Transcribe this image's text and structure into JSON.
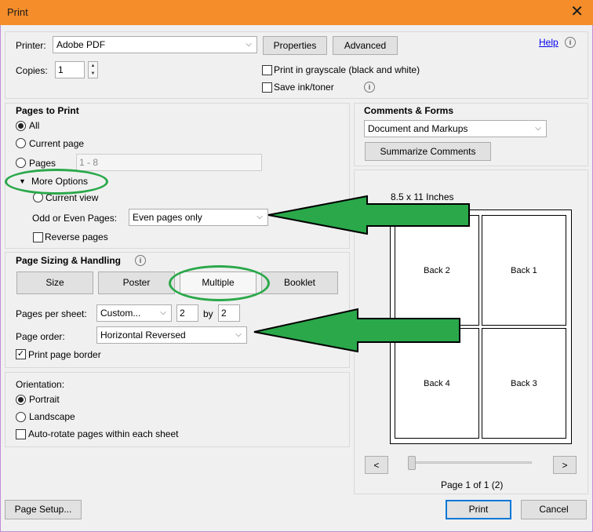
{
  "window": {
    "title": "Print",
    "close_glyph": "✕"
  },
  "printer": {
    "label": "Printer:",
    "value": "Adobe PDF",
    "properties_label": "Properties",
    "advanced_label": "Advanced",
    "help_label": "Help"
  },
  "copies": {
    "label": "Copies:",
    "value": "1"
  },
  "options": {
    "grayscale_label": "Print in grayscale (black and white)",
    "save_ink_label": "Save ink/toner"
  },
  "pages_to_print": {
    "heading": "Pages to Print",
    "all_label": "All",
    "current_page_label": "Current page",
    "pages_label": "Pages",
    "pages_value": "1 - 8",
    "more_options_label": "More Options",
    "current_view_label": "Current view",
    "odd_even_label": "Odd or Even Pages:",
    "odd_even_value": "Even pages only",
    "reverse_label": "Reverse pages"
  },
  "sizing": {
    "heading": "Page Sizing & Handling",
    "tabs": [
      "Size",
      "Poster",
      "Multiple",
      "Booklet"
    ],
    "pages_per_sheet_label": "Pages per sheet:",
    "pages_per_sheet_value": "Custom...",
    "cols_value": "2",
    "by_label": "by",
    "rows_value": "2",
    "page_order_label": "Page order:",
    "page_order_value": "Horizontal Reversed",
    "border_label": "Print page border"
  },
  "orientation": {
    "heading": "Orientation:",
    "portrait_label": "Portrait",
    "landscape_label": "Landscape",
    "autorotate_label": "Auto-rotate pages within each sheet"
  },
  "comments": {
    "heading": "Comments & Forms",
    "value": "Document and Markups",
    "summarize_label": "Summarize Comments"
  },
  "preview": {
    "size_label": "8.5 x 11 Inches",
    "pages": [
      "Back 2",
      "Back 1",
      "Back 4",
      "Back 3"
    ],
    "prev_label": "<",
    "next_label": ">",
    "page_counter": "Page 1 of 1 (2)",
    "slider_position": 0
  },
  "footer": {
    "page_setup_label": "Page Setup...",
    "print_label": "Print",
    "cancel_label": "Cancel"
  },
  "annotation_color": "#2aa84a"
}
